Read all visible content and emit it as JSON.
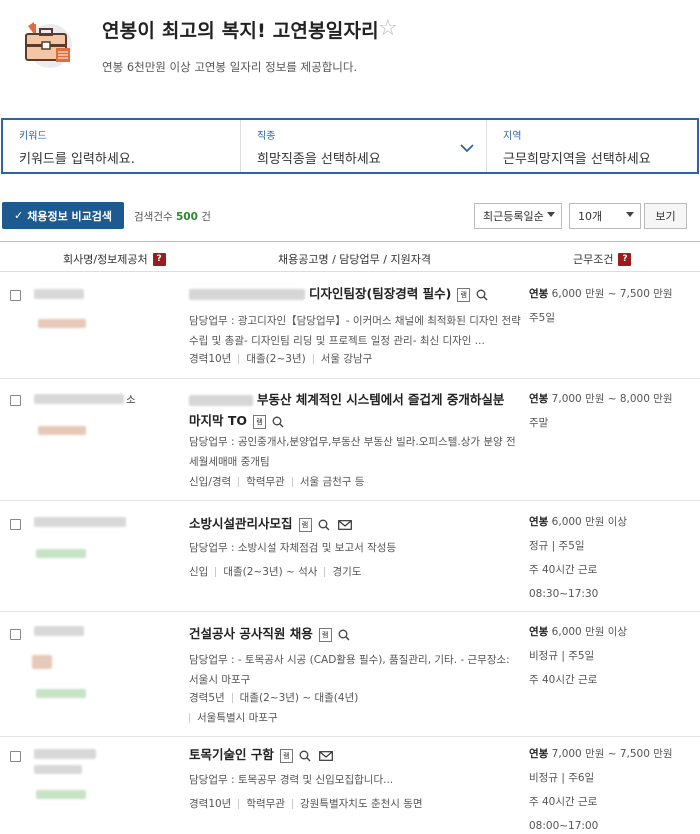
{
  "header": {
    "title": "연봉이 최고의 복지! 고연봉일자리",
    "subtitle": "연봉 6천만원 이상 고연봉 일자리 정보를 제공합니다.",
    "star": "☆"
  },
  "search": {
    "keyword": {
      "label": "키워드",
      "value": "키워드를 입력하세요."
    },
    "job": {
      "label": "직종",
      "value": "희망직종을 선택하세요"
    },
    "region": {
      "label": "지역",
      "value": "근무희망지역을 선택하세요"
    }
  },
  "toolbar": {
    "compare_label": "채용정보 비교검색",
    "count_label": "검색건수",
    "count_value": "500",
    "count_unit": "건",
    "sort_value": "최근등록일순",
    "page_size_value": "10개",
    "view_label": "보기"
  },
  "table_headers": {
    "company": "회사명/정보제공처",
    "posting": "채용공고명 / 담당업무 / 지원자격",
    "conditions": "근무조건"
  },
  "rows": [
    {
      "company_suffix": "",
      "title": "디자인팀장(팀장경력 필수)",
      "duty": "담당업무 : 광고디자인【담당업무】- 이커머스 채널에 최적화된 디자인 전략 수립 및 총괄- 디자인팀 리딩 및 프로젝트 일정 관리- 최신 디자인 ...",
      "meta": [
        "경력10년",
        "대졸(2~3년)",
        "서울 강남구"
      ],
      "salary_label": "연봉",
      "salary": "6,000 만원 ~ 7,500 만원",
      "conditions": [
        "주5일"
      ]
    },
    {
      "company_suffix": "소",
      "title": "부동산 체계적인 시스템에서 즐겁게 중개하실분 마지막 TO",
      "duty": "담당업무 : 공인중개사,분양업무,부동산 부동산 빌라.오피스텔.상가 분양 전세월세매매 중개팀",
      "meta": [
        "신입/경력",
        "학력무관",
        "서울 금천구 등"
      ],
      "salary_label": "연봉",
      "salary": "7,000 만원 ~ 8,000 만원",
      "conditions": [
        "주말"
      ]
    },
    {
      "company_suffix": "",
      "title": "소방시설관리사모집",
      "duty": "담당업무 : 소방시설 자체점검 및 보고서 작성등",
      "meta": [
        "신입",
        "대졸(2~3년) ~ 석사",
        "경기도"
      ],
      "salary_label": "연봉",
      "salary": "6,000 만원 이상",
      "conditions": [
        "정규 | 주5일",
        "주 40시간 근로",
        "08:30~17:30"
      ]
    },
    {
      "company_suffix": "",
      "title": "건설공사 공사직원 채용",
      "duty": "담당업무 : - 토목공사 시공 (CAD활용 필수), 품질관리, 기타. - 근무장소: 서울시 마포구",
      "meta": [
        "경력5년",
        "대졸(2~3년) ~ 대졸(4년)",
        "서울특별시 마포구"
      ],
      "salary_label": "연봉",
      "salary": "6,000 만원 이상",
      "conditions": [
        "비정규 | 주5일",
        "주 40시간 근로"
      ]
    },
    {
      "company_suffix": "",
      "title": "토목기술인 구함",
      "duty": "담당업무 : 토목공무 경력 및 신입모집합니다...",
      "meta": [
        "경력10년",
        "학력무관",
        "강원특별자치도 춘천시 동면"
      ],
      "salary_label": "연봉",
      "salary": "7,000 만원 ~ 7,500 만원",
      "conditions": [
        "비정규 | 주6일",
        "주 40시간 근로",
        "08:00~17:00"
      ]
    }
  ],
  "icons": {
    "info_badge": "i",
    "question_badge": "?",
    "info_tag": "램"
  },
  "colors": {
    "accent": "#2e64a6",
    "button": "#1d5a8f",
    "count": "#2c8a2c",
    "badge": "#9c1c1c"
  }
}
